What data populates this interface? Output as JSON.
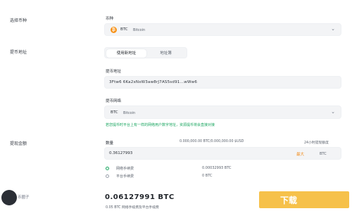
{
  "colors": {
    "accent": "#f7931a",
    "success": "#1aa660",
    "max": "#f28c1b",
    "banner": "#f6c14a"
  },
  "section_network": "选择币种",
  "currency": {
    "label": "币种",
    "symbol": "BTC",
    "name": "Bitcoin",
    "icon": "bitcoin-icon"
  },
  "section_address": "提币地址",
  "tabs": [
    "使用新地址",
    "地址簿"
  ],
  "address": {
    "label": "提币地址",
    "value": "3Ftw6 6Ka2xNxW3aw8rJ7AS5sd91...wWw6"
  },
  "network": {
    "label": "提币网络",
    "symbol": "BTC",
    "name": "Bitcoin",
    "hint": "若您提币时平台上有一样的网络用户数字地址，资源提币将会直接对接"
  },
  "section_amount": "提现金额",
  "amount": {
    "label": "数量",
    "range": "0.000,000.00 BTC/0.000,000.00 $USD",
    "limit": "24小时提现额度",
    "value": "0.36127993",
    "max_label": "最大",
    "unit": "BTC"
  },
  "fees": [
    {
      "label": "网络手续费",
      "value": "0.00032993 BTC"
    },
    {
      "label": "平台手续费",
      "value": "0 BTC"
    }
  ],
  "receive": {
    "value": "0.06127991 BTC",
    "note": "0.05 BTC 网络手续费及平台手续费"
  },
  "watermark": "币圈子",
  "banner_text": "下载"
}
